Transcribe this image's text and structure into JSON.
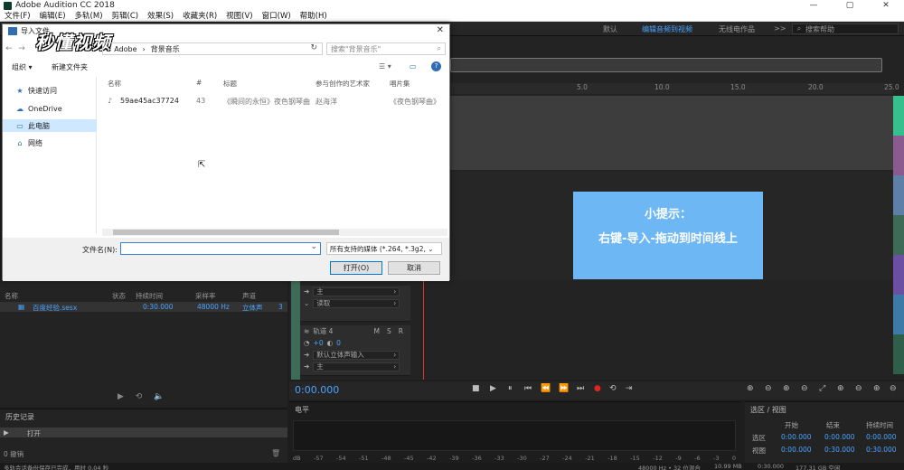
{
  "app": {
    "title": "Adobe Audition CC 2018",
    "win_min": "—",
    "win_max": "▢",
    "win_close": "✕"
  },
  "menu": [
    "文件(F)",
    "编辑(E)",
    "多轨(M)",
    "剪辑(C)",
    "效果(S)",
    "收藏夹(R)",
    "视图(V)",
    "窗口(W)",
    "帮助(H)"
  ],
  "workspaces": {
    "default": "默认",
    "edit_video": "编辑音频到视频",
    "radio": "无线电作品",
    "more": ">>",
    "search_placeholder": "搜索帮助"
  },
  "ruler_ticks": [
    "5.0",
    "10.0",
    "15.0",
    "20.0",
    "25.0"
  ],
  "tip": {
    "line1": "小提示：",
    "line2": "右键-导入-拖动到时间线上"
  },
  "tracks": {
    "master_label": "主",
    "read_label": "读取",
    "track4_name": "轨道 4",
    "m": "M",
    "s": "S",
    "r": "R",
    "vol": "+0",
    "pan": "0",
    "input": "默认立体声输入",
    "output": "主"
  },
  "transport": {
    "time": "0:00.000"
  },
  "files_panel": {
    "headers": [
      "名称",
      "状态",
      "持续时间",
      "采样率",
      "声道"
    ],
    "row": {
      "name": "百度经验.sesx",
      "duration": "0:30.000",
      "rate": "48000 Hz",
      "channels": "立体声",
      "extra": "3"
    }
  },
  "history": {
    "title": "历史记录",
    "item": "打开",
    "footer": "0 撤销"
  },
  "levels": {
    "title": "电平",
    "scale": [
      "dB",
      "-57",
      "-54",
      "-51",
      "-48",
      "-45",
      "-42",
      "-39",
      "-36",
      "-33",
      "-30",
      "-27",
      "-24",
      "-21",
      "-18",
      "-15",
      "-12",
      "-9",
      "-6",
      "-3",
      "0"
    ]
  },
  "selview": {
    "title": "选区 / 视图",
    "col_start": "开始",
    "col_end": "结束",
    "col_dur": "持续时间",
    "row_sel": "选区",
    "row_view": "视图",
    "sel_start": "0:00.000",
    "sel_end": "0:00.000",
    "sel_dur": "0:00.000",
    "view_start": "0:00.000",
    "view_end": "0:30.000",
    "view_dur": "0:30.000"
  },
  "status": {
    "left": "多轨会话备份保存已完成，用时 0.04 秒",
    "rate": "48000 Hz • 32 位混合",
    "size": "10.99 MB",
    "dur": "0:30.000",
    "free": "177.31 GB 空闲"
  },
  "dialog": {
    "title": "导入文件",
    "close": "✕",
    "watermark": "秒懂视频",
    "breadcrumb": [
      "Adobe",
      "背景音乐"
    ],
    "search_placeholder": "搜索\"背景音乐\"",
    "organize": "组织 ▾",
    "new_folder": "新建文件夹",
    "help": "?",
    "nav_items": [
      "快速访问",
      "OneDrive",
      "此电脑",
      "网络"
    ],
    "columns": [
      "名称",
      "#",
      "标题",
      "参与创作的艺术家",
      "唱片集"
    ],
    "file": {
      "name": "59ae45ac37724",
      "num": "43",
      "title": "《瞬间的永恒》夜色钢琴曲",
      "artist": "赵海洋",
      "album": "《夜色钢琴曲》"
    },
    "filename_label": "文件名(N):",
    "filename_value": "",
    "filetype": "所有支持的媒体 (*.264, *.3g2, ⌄",
    "open_btn": "打开(O)",
    "cancel_btn": "取消"
  },
  "colors": {
    "accent_blue": "#4aa3ff",
    "tip_bg": "#6db7f5",
    "record_red": "#e02424",
    "track_green": "#3e6b57"
  }
}
